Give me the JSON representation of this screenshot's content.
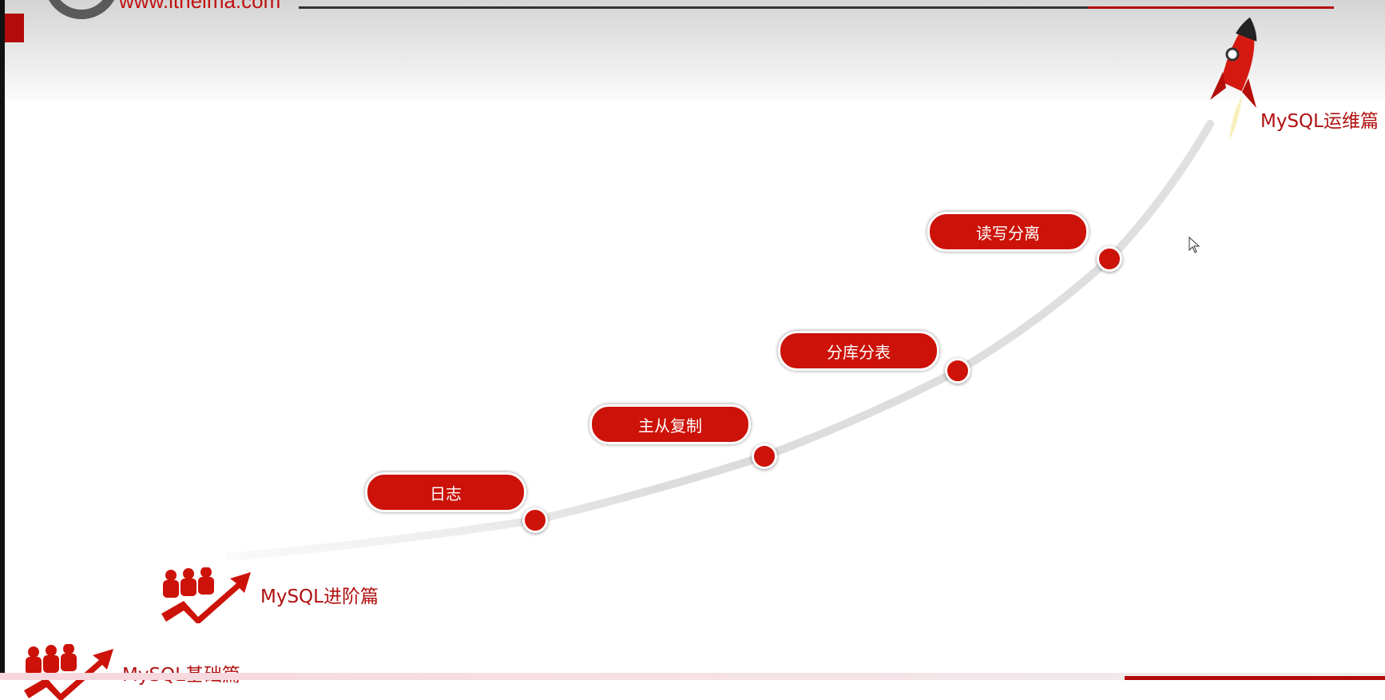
{
  "header": {
    "site_url": "www.itheima.com"
  },
  "levels": {
    "basic": "MySQL基础篇",
    "advanced": "MySQL进阶篇",
    "ops": "MySQL运维篇"
  },
  "milestones": [
    {
      "label": "日志"
    },
    {
      "label": "主从复制"
    },
    {
      "label": "分库分表"
    },
    {
      "label": "读写分离"
    }
  ],
  "colors": {
    "accent": "#cc1209",
    "curve": "#d8d8d8"
  },
  "icons": [
    "people-growth-arrow-icon",
    "rocket-icon",
    "mouse-cursor-icon"
  ]
}
